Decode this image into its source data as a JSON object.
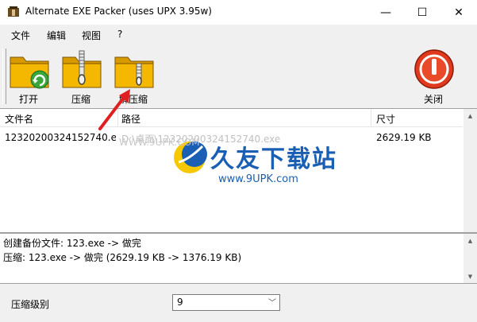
{
  "window": {
    "title": "Alternate EXE Packer (uses UPX 3.95w)",
    "minimize_glyph": "—",
    "maximize_glyph": "☐",
    "close_glyph": "✕"
  },
  "menu": [
    "文件",
    "编辑",
    "视图",
    "?"
  ],
  "toolbar": {
    "open_label": "打开",
    "compress_label": "压缩",
    "decompress_label": "解压缩",
    "close_label": "关闭"
  },
  "list": {
    "columns": [
      "文件名",
      "路径",
      "尺寸"
    ],
    "rows": [
      {
        "name": "12320200324152740.e...",
        "path": "D:\\桌面\\12320200324152740.exe",
        "size": "2629.19 KB"
      }
    ]
  },
  "watermark": {
    "title": "久友下载站",
    "url": "www.9UPK.com",
    "faint": "WWW.9UPK.COM"
  },
  "log": [
    "创建备份文件: 123.exe -> 做完",
    "压缩: 123.exe -> 做完 (2629.19 KB -> 1376.19 KB)"
  ],
  "compression": {
    "label": "压缩级别",
    "value": "9"
  },
  "colors": {
    "folder": "#f5b800",
    "close_red": "#e03a1e",
    "arrow_red": "#e02020",
    "watermark_blue": "#1a5fb4"
  }
}
